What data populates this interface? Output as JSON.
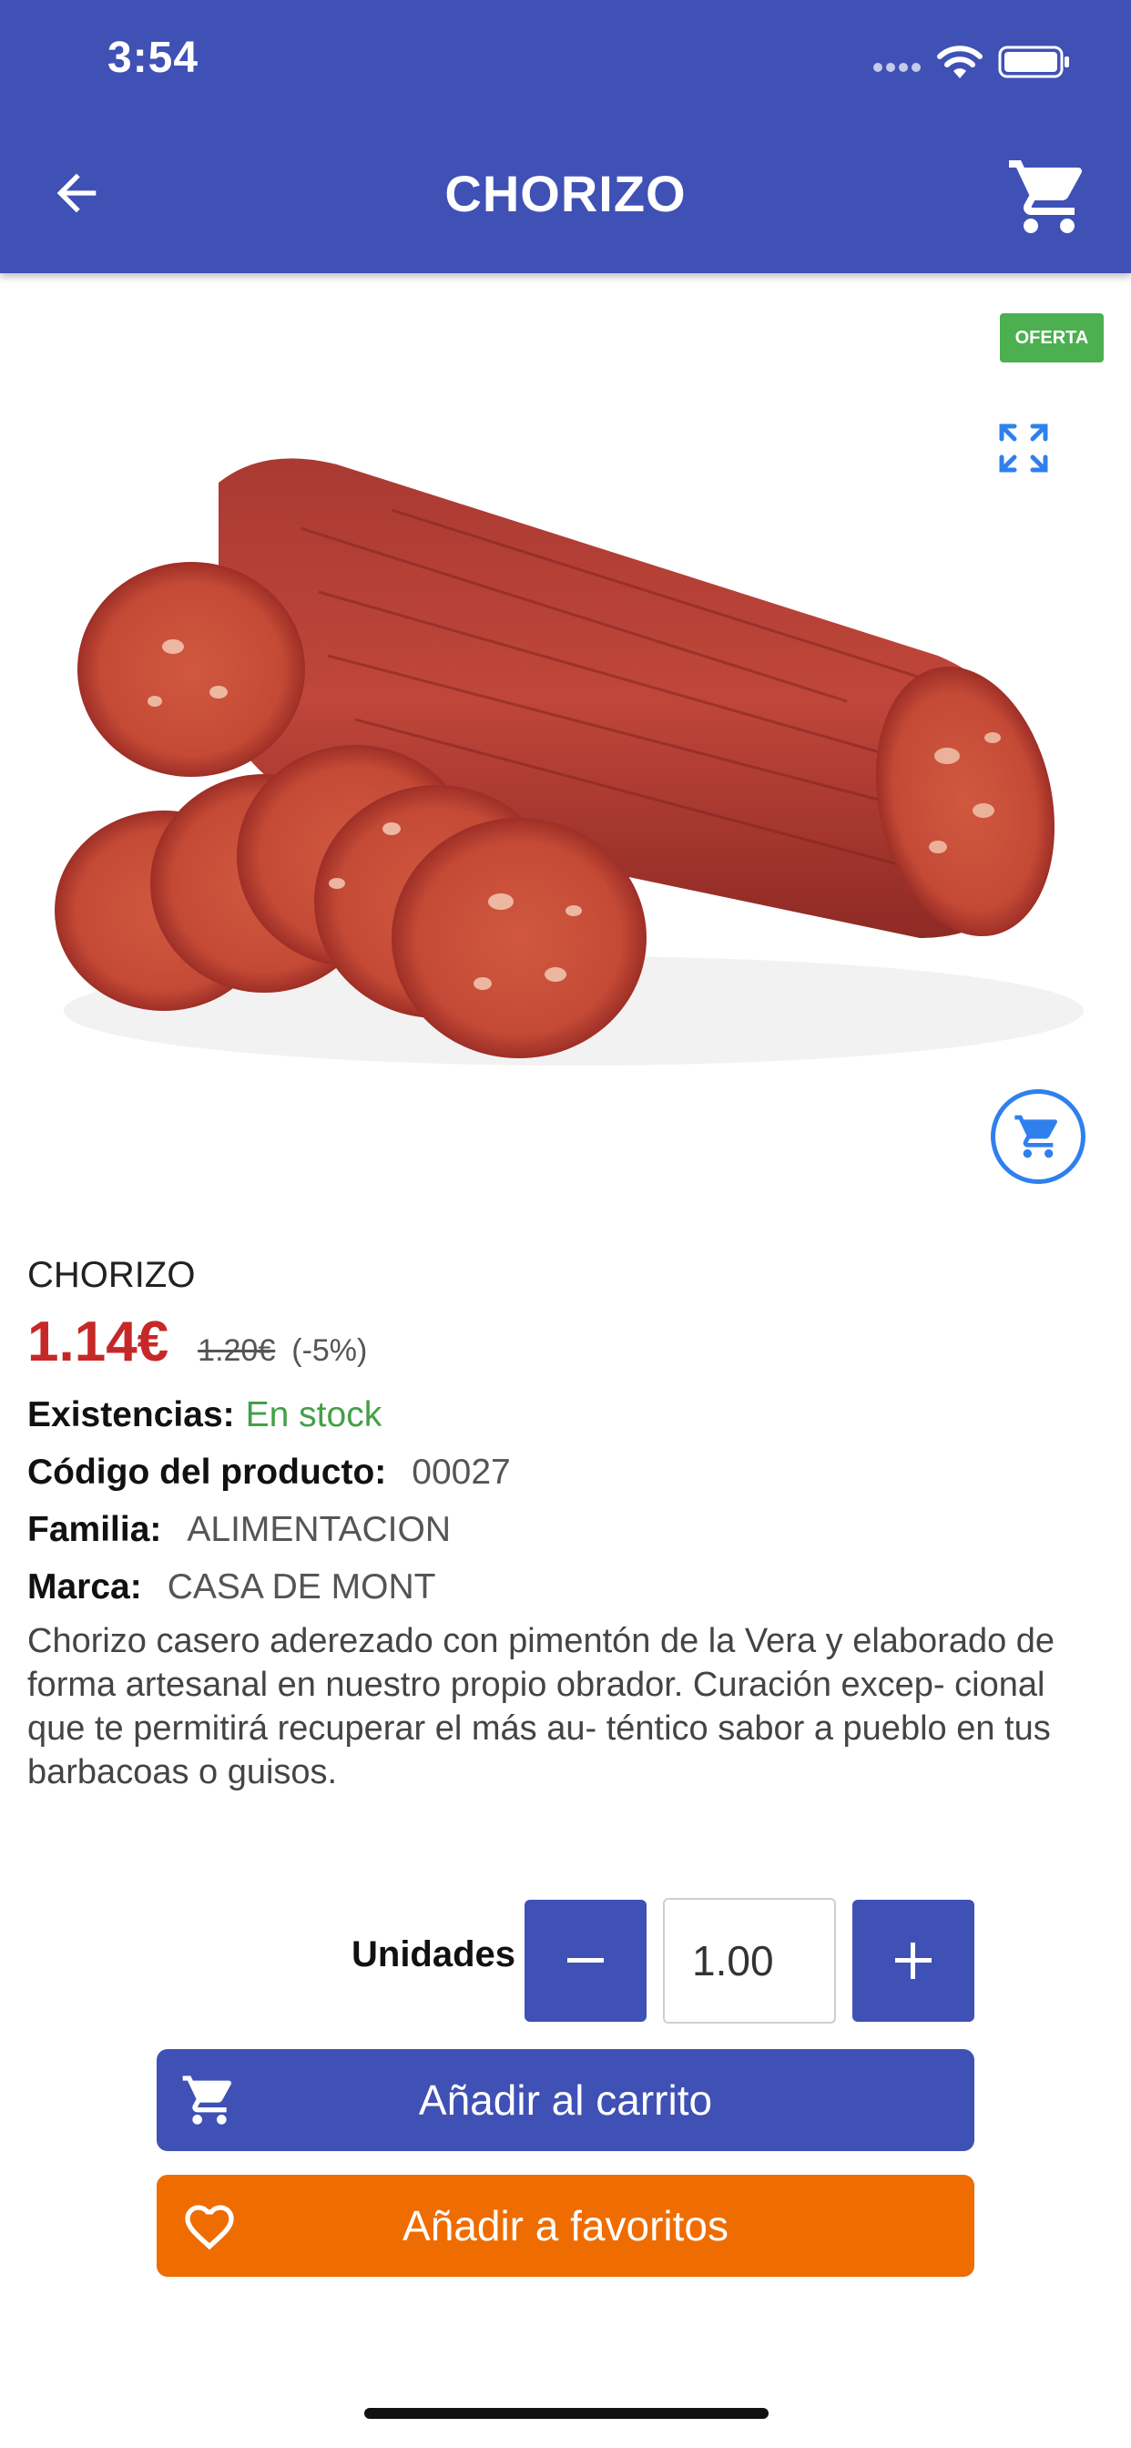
{
  "status": {
    "time": "3:54"
  },
  "header": {
    "title": "CHORIZO"
  },
  "image": {
    "badge": "OFERTA"
  },
  "product": {
    "name": "CHORIZO",
    "price": "1.14€",
    "old_price": "1.20€",
    "discount": "(-5%)",
    "stock_label": "Existencias:",
    "stock_value": "En stock",
    "code_label": "Código del producto:",
    "code_value": "00027",
    "family_label": "Familia:",
    "family_value": "ALIMENTACION",
    "brand_label": "Marca:",
    "brand_value": "CASA DE MONT",
    "description": "Chorizo casero aderezado con pimentón de la Vera y elaborado de forma artesanal en nuestro propio obrador. Curación excep- cional que te permitirá recuperar el más au- téntico sabor a pueblo en tus barbacoas o guisos."
  },
  "quantity": {
    "label": "Unidades",
    "value": "1.00"
  },
  "actions": {
    "add_to_cart": "Añadir al carrito",
    "add_to_favorites": "Añadir a favoritos"
  },
  "colors": {
    "primary": "#3f51b5",
    "price": "#c62828",
    "stock": "#43a047",
    "badge": "#4caf50",
    "favorites": "#ef6c00"
  }
}
